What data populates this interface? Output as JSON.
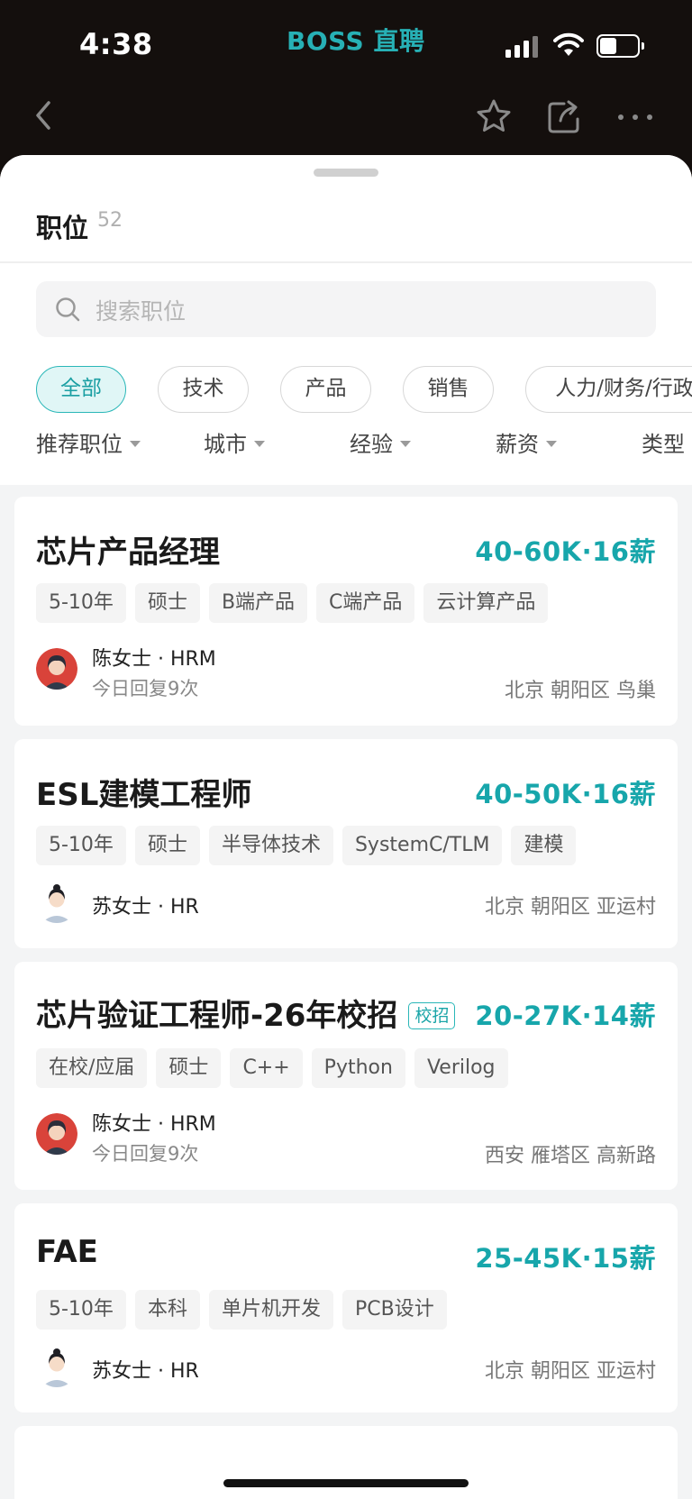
{
  "status_bar": {
    "time": "4:38",
    "app_brand": "BOSS 直聘"
  },
  "sheet": {
    "title": "职位",
    "count": "52",
    "search_placeholder": "搜索职位"
  },
  "chips": [
    "全部",
    "技术",
    "产品",
    "销售",
    "人力/财务/行政"
  ],
  "active_chip": "全部",
  "filters": [
    "推荐职位",
    "城市",
    "经验",
    "薪资",
    "类型"
  ],
  "jobs": [
    {
      "title": "芯片产品经理",
      "badge": "",
      "salary": "40-60K·16薪",
      "tags": [
        "5-10年",
        "硕士",
        "B端产品",
        "C端产品",
        "云计算产品"
      ],
      "recruiter": "陈女士 · HRM",
      "reply": "今日回复9次",
      "location": "北京 朝阳区 鸟巢"
    },
    {
      "title": "ESL建模工程师",
      "badge": "",
      "salary": "40-50K·16薪",
      "tags": [
        "5-10年",
        "硕士",
        "半导体技术",
        "SystemC/TLM",
        "建模"
      ],
      "recruiter": "苏女士 · HR",
      "reply": "",
      "location": "北京 朝阳区 亚运村"
    },
    {
      "title": "芯片验证工程师-26年校招",
      "badge": "校招",
      "salary": "20-27K·14薪",
      "tags": [
        "在校/应届",
        "硕士",
        "C++",
        "Python",
        "Verilog"
      ],
      "recruiter": "陈女士 · HRM",
      "reply": "今日回复9次",
      "location": "西安 雁塔区 高新路"
    },
    {
      "title": "FAE",
      "badge": "",
      "salary": "25-45K·15薪",
      "tags": [
        "5-10年",
        "本科",
        "单片机开发",
        "PCB设计"
      ],
      "recruiter": "苏女士 · HR",
      "reply": "",
      "location": "北京 朝阳区 亚运村"
    }
  ],
  "colors": {
    "accent": "#17a6ab",
    "top_bar": "#140f0d",
    "sheet_bg": "#f3f4f5"
  },
  "icons": [
    "back-icon",
    "star-icon",
    "share-icon",
    "more-icon",
    "search-icon"
  ]
}
